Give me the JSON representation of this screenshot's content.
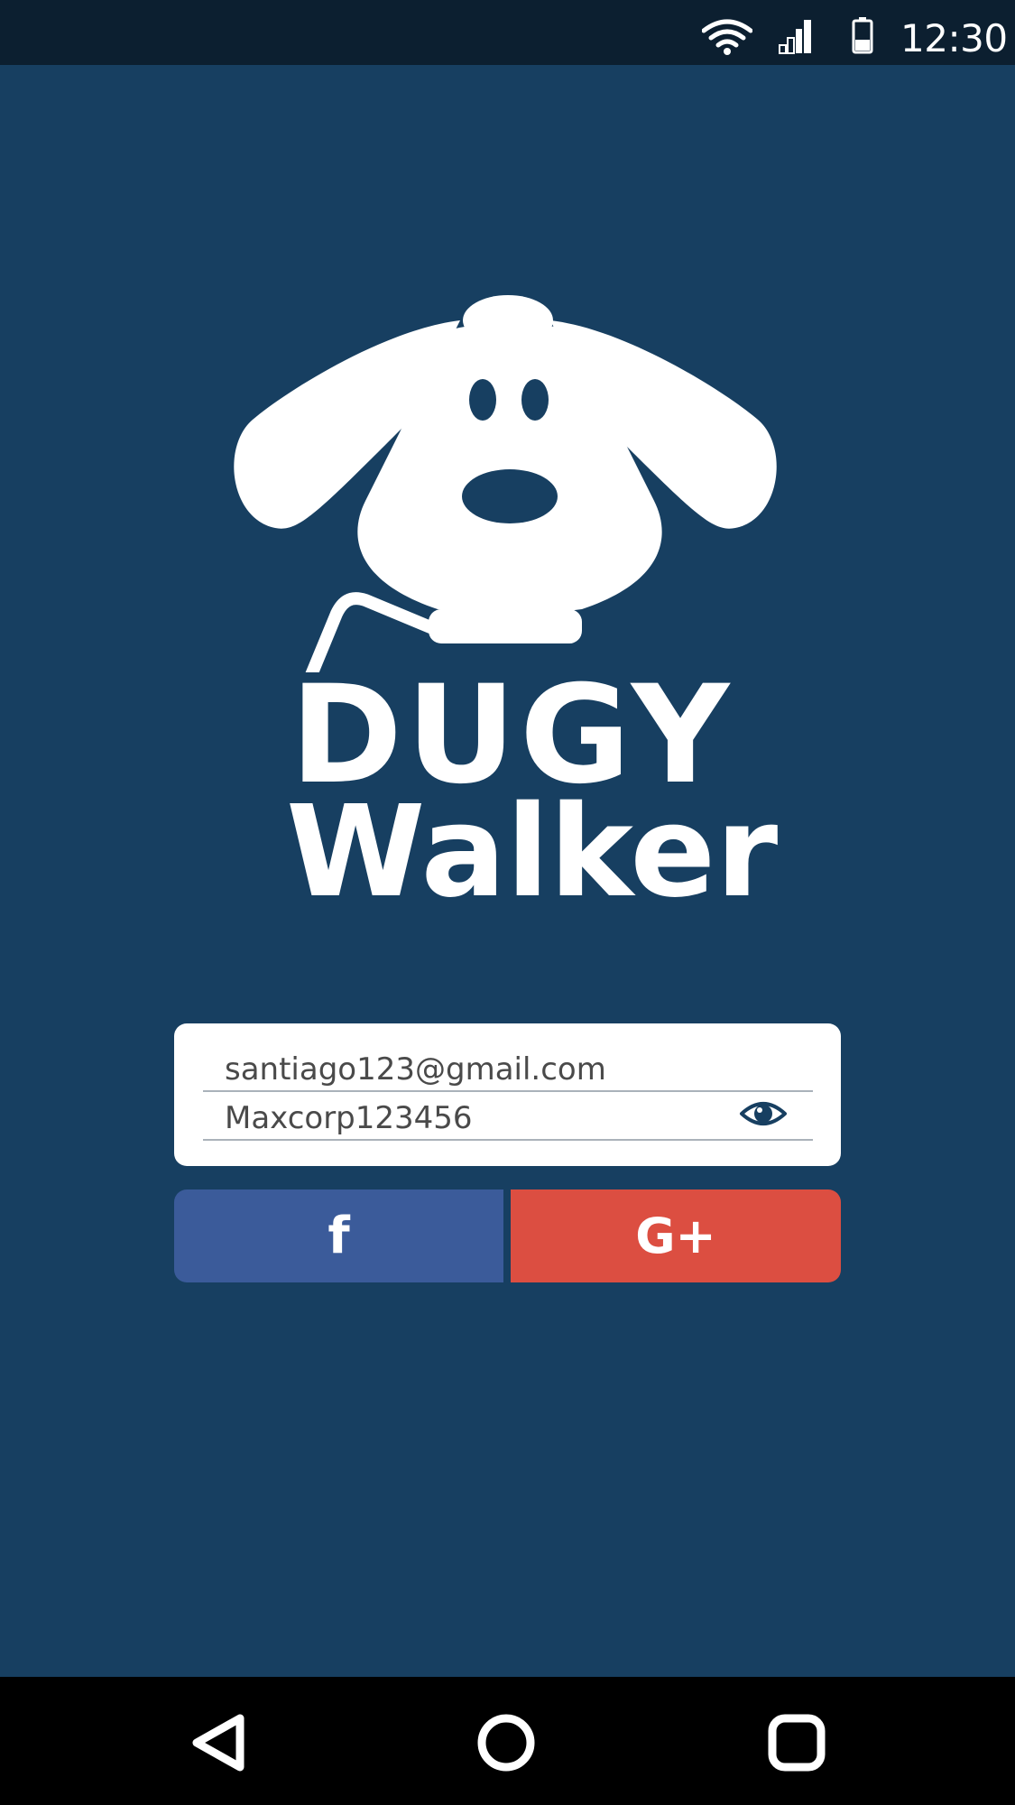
{
  "status_bar": {
    "time": "12:30",
    "icons": [
      "wifi-icon",
      "signal-icon",
      "battery-icon"
    ]
  },
  "logo": {
    "line1": "DUGY",
    "line2": "Walker"
  },
  "login": {
    "email_value": "santiago123@gmail.com",
    "password_value": "Maxcorp123456",
    "password_toggle_icon": "eye-icon"
  },
  "social": {
    "facebook_label": "f",
    "google_label": "G+",
    "facebook_color": "#3b5b9a",
    "google_color": "#dc4e41"
  },
  "nav": {
    "icons": [
      "back-icon",
      "home-icon",
      "recent-apps-icon"
    ]
  },
  "colors": {
    "background": "#173f61",
    "status_bar": "#0c1f30",
    "nav_bar": "#000000"
  }
}
